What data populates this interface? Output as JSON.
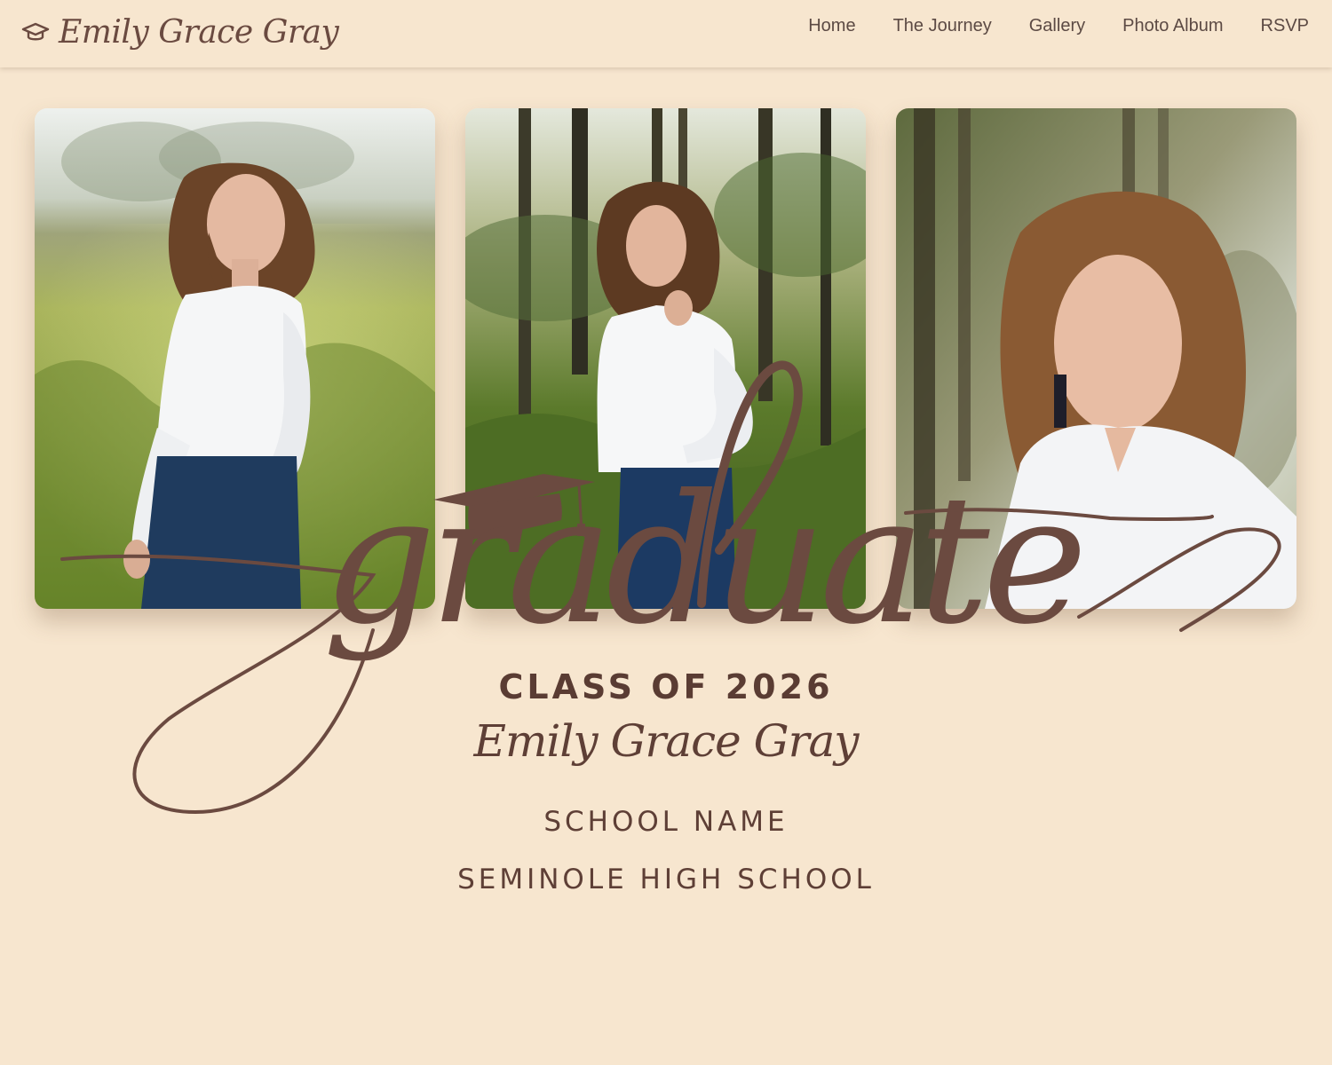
{
  "site": {
    "brand_name": "Emily Grace Gray",
    "brand_icon": "graduation-cap-icon"
  },
  "nav": {
    "items": [
      {
        "label": "Home"
      },
      {
        "label": "The Journey"
      },
      {
        "label": "Gallery"
      },
      {
        "label": "Photo Album"
      },
      {
        "label": "RSVP"
      }
    ]
  },
  "hero": {
    "photos": [
      {
        "alt": "graduate-photo-1"
      },
      {
        "alt": "graduate-photo-2"
      },
      {
        "alt": "graduate-photo-3"
      }
    ],
    "script_word": "graduate",
    "class_of": "CLASS OF 2026",
    "graduate_name": "Emily Grace Gray",
    "school_label": "SCHOOL NAME",
    "school_value": "SEMINOLE HIGH SCHOOL"
  },
  "colors": {
    "background": "#f7e6cf",
    "accent": "#6b4a40",
    "text": "#5e3f36"
  }
}
